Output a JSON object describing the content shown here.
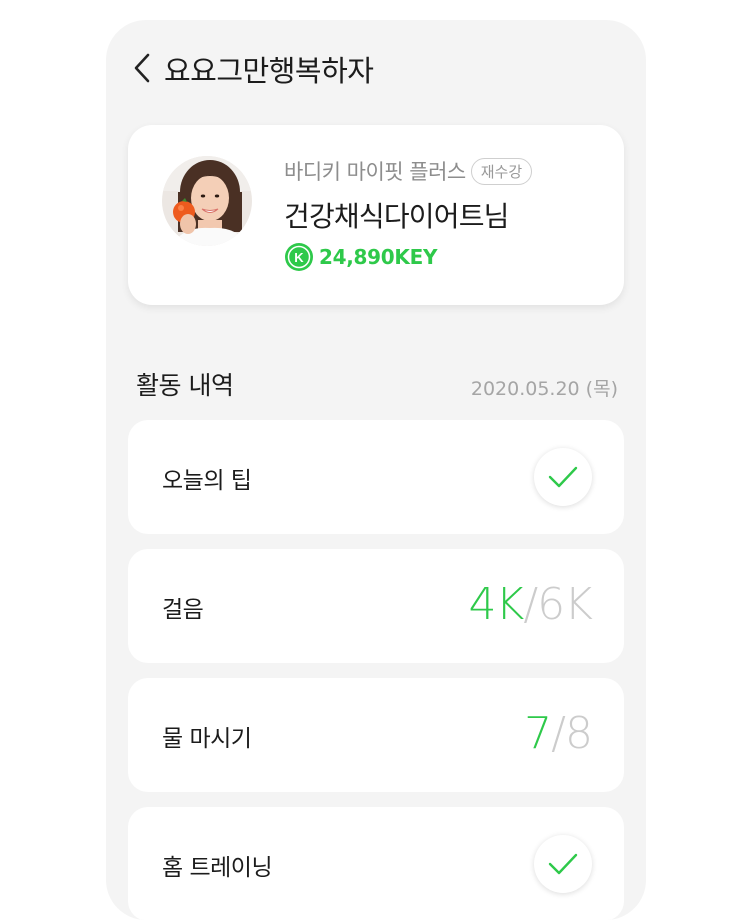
{
  "header": {
    "title": "요요그만행복하자"
  },
  "profile": {
    "program_name": "바디키 마이핏 플러스",
    "badge": "재수강",
    "user_name": "건강채식다이어트님",
    "key_icon_letter": "K",
    "key_amount": "24,890KEY"
  },
  "activity": {
    "title": "활동 내역",
    "date": "2020.05.20 (목)",
    "items": [
      {
        "label": "오늘의 팁",
        "type": "check",
        "icon": "checkmark-icon"
      },
      {
        "label": "걸음",
        "type": "progress",
        "current": "4K",
        "separator": "/",
        "total": "6K"
      },
      {
        "label": "물 마시기",
        "type": "progress",
        "current": "7",
        "separator": "/",
        "total": "8"
      },
      {
        "label": "홈 트레이닝",
        "type": "check",
        "icon": "checkmark-icon"
      }
    ]
  },
  "colors": {
    "accent_green": "#2ec94a",
    "background": "#f4f4f4",
    "card": "#ffffff",
    "muted": "#cccccc"
  }
}
